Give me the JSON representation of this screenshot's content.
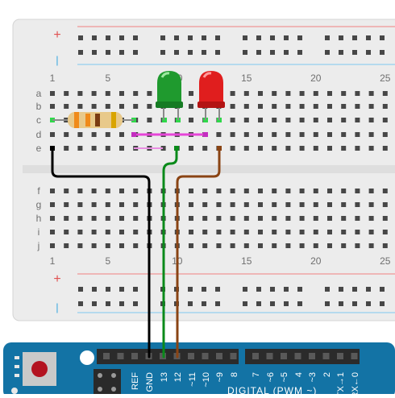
{
  "breadboard": {
    "power_plus": "+",
    "power_minus": "|",
    "column_numbers": [
      "1",
      "5",
      "10",
      "15",
      "20",
      "25"
    ],
    "row_letters_top": [
      "a",
      "b",
      "c",
      "d",
      "e"
    ],
    "row_letters_bottom": [
      "f",
      "g",
      "h",
      "i",
      "j"
    ]
  },
  "components": {
    "resistor": {
      "bands": [
        "#f08a1a",
        "#f08a1a",
        "#7a3b12",
        "#d9a400"
      ],
      "body_color": "#e8c98a"
    },
    "led_green": {
      "color": "#1f9a2e"
    },
    "led_red": {
      "color": "#e01e1e"
    }
  },
  "wires": {
    "ground": "#000000",
    "green": "#0a8a1a",
    "brown": "#8a4414",
    "jumper": "#e645d8"
  },
  "arduino": {
    "board_color": "#1373a5",
    "reset_color": "#b3121f",
    "header_labels": [
      "REF",
      "GND",
      "13",
      "12",
      "~11",
      "~10",
      "~9",
      "8",
      "7",
      "~6",
      "~5",
      "4",
      "~3",
      "2",
      "TX→1",
      "RX←0"
    ],
    "digital_label": "DIGITAL (PWM ~)"
  }
}
